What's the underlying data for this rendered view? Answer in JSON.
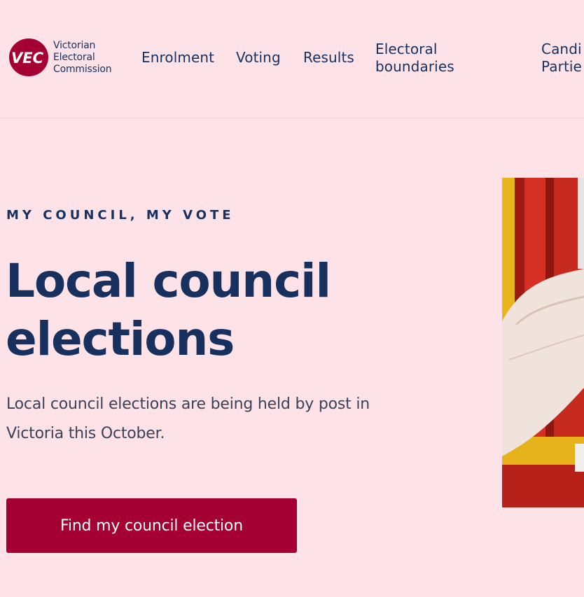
{
  "logo": {
    "mark_text": "VEC",
    "lines": [
      "Victorian",
      "Electoral",
      "Commission"
    ]
  },
  "nav": {
    "items": [
      {
        "label": "Enrolment"
      },
      {
        "label": "Voting"
      },
      {
        "label": "Results"
      },
      {
        "label_line1": "Electoral",
        "label_line2": "boundaries"
      },
      {
        "label_line1": "Candi",
        "label_line2": "Partie"
      }
    ]
  },
  "hero": {
    "eyebrow": "MY COUNCIL, MY VOTE",
    "title_line1": "Local council",
    "title_line2": "elections",
    "description": "Local council elections are being held by post in Victoria this October.",
    "cta_label": "Find my council election"
  },
  "colors": {
    "background": "#fde3e8",
    "navy": "#17305e",
    "brand_red": "#a50034",
    "text_grey": "#3b4255"
  }
}
